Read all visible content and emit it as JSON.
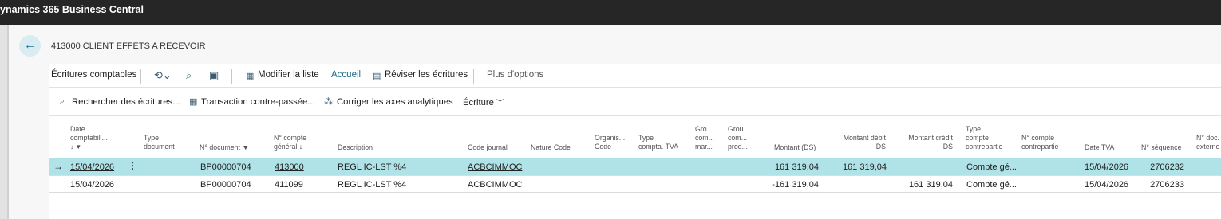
{
  "app": {
    "title": "ynamics 365 Business Central"
  },
  "page": {
    "title": "413000 CLIENT EFFETS A RECEVOIR",
    "back_icon": "←"
  },
  "actionbar": {
    "list_title": "Écritures comptables",
    "modify_list": "Modifier la liste",
    "home": "Accueil",
    "review": "Réviser les écritures",
    "more": "Plus d'options"
  },
  "subbar": {
    "search_entries": "Rechercher des écritures...",
    "reverse_transaction": "Transaction contre-passée...",
    "correct_dimensions": "Corriger les axes analytiques",
    "entry_menu": "Écriture"
  },
  "columns": {
    "posting_date": [
      "Date",
      "comptabili...",
      "↓ ▼"
    ],
    "doc_type": [
      "Type",
      "document"
    ],
    "doc_no": "N° document ▼",
    "account_no": [
      "N° compte",
      "général ↓"
    ],
    "description": "Description",
    "journal_code": "Code journal",
    "nature_code": "Nature Code",
    "org_code": [
      "Organis...",
      "Code"
    ],
    "vat_type": [
      "Type",
      "compta. TVA"
    ],
    "gen_bus": [
      "Gro...",
      "com...",
      "mar..."
    ],
    "gen_prod": [
      "Grou...",
      "com...",
      "prod..."
    ],
    "amount": "Montant (DS)",
    "debit": [
      "Montant débit",
      "DS"
    ],
    "credit": [
      "Montant crédit",
      "DS"
    ],
    "bal_type": [
      "Type",
      "compte",
      "contrepartie"
    ],
    "bal_no": [
      "N° compte",
      "contrepartie"
    ],
    "vat_date": "Date TVA",
    "seq_no": "N° séquence",
    "ext_doc": [
      "N° doc.",
      "externe"
    ]
  },
  "rows": [
    {
      "posting_date": "15/04/2026",
      "doc_no": "BP00000704",
      "account_no": "413000",
      "description": "REGL IC-LST %4",
      "journal_code": "ACBCIMMOC",
      "amount": "161 319,04",
      "debit": "161 319,04",
      "credit": "",
      "bal_type": "Compte gé...",
      "vat_date": "15/04/2026",
      "seq_no": "2706232"
    },
    {
      "posting_date": "15/04/2026",
      "doc_no": "BP00000704",
      "account_no": "411099",
      "description": "REGL IC-LST %4",
      "journal_code": "ACBCIMMOC",
      "amount": "-161 319,04",
      "debit": "",
      "credit": "161 319,04",
      "bal_type": "Compte gé...",
      "vat_date": "15/04/2026",
      "seq_no": "2706233"
    }
  ]
}
